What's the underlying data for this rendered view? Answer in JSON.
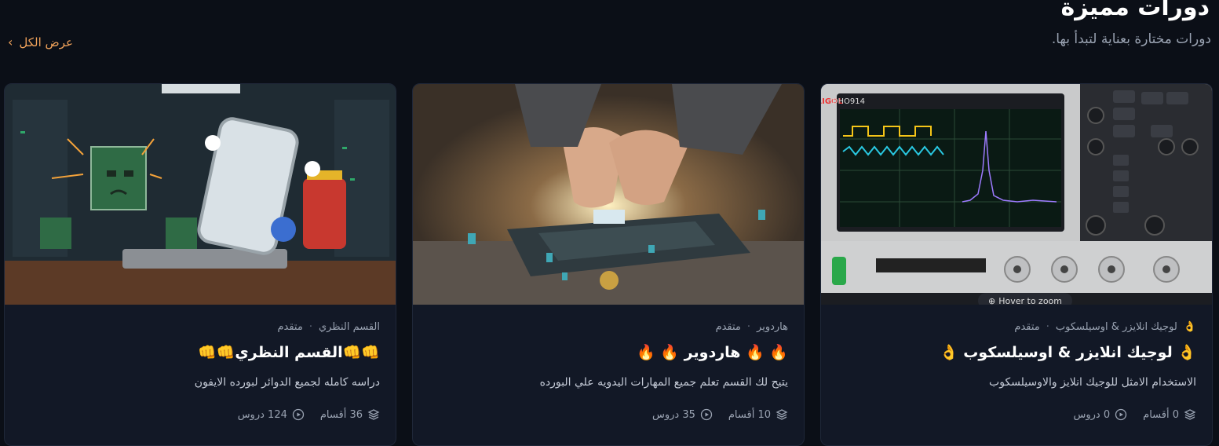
{
  "header": {
    "title": "دورات مميزة",
    "subtitle": "دورات مختارة بعناية لتبدأ بها.",
    "view_all": "عرض الكل"
  },
  "cards": [
    {
      "category": "لوجيك انلايزر & اوسيلسكوب",
      "category_emoji": "👌",
      "level": "متقدم",
      "title": "👌 لوجيك انلايزر & اوسيلسكوب 👌",
      "description": "الاستخدام الامثل للوجيك انلايز والاوسيلسكوب",
      "sections": "0 أقسام",
      "lessons": "0 دروس",
      "thumb_overlay": "Hover to zoom",
      "thumb_brand": "RIGOL DHO914"
    },
    {
      "category": "هاردوير",
      "category_emoji": "",
      "level": "متقدم",
      "title": "🔥 🔥 هاردوير 🔥 🔥",
      "description": "يتيح لك القسم تعلم جميع المهارات اليدويه علي البورده",
      "sections": "10 أقسام",
      "lessons": "35 دروس"
    },
    {
      "category": "القسم النظري",
      "category_emoji": "",
      "level": "متقدم",
      "title": "👊👊القسم النظري👊👊",
      "description": "دراسه كامله لجميع الدوائر لبورده الايفون",
      "sections": "36 أقسام",
      "lessons": "124 دروس"
    }
  ],
  "colors": {
    "background": "#0b0f17",
    "card": "#121826",
    "accent": "#f0a25a"
  }
}
